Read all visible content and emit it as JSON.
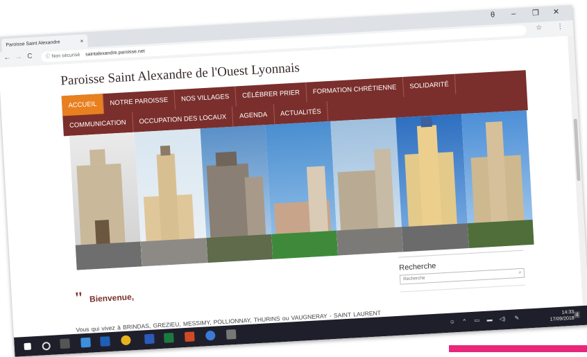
{
  "browser": {
    "tab_title": "Paroisse Saint Alexandre",
    "tab_close": "×",
    "back": "←",
    "forward": "→",
    "reload": "C",
    "security": "ⓘ Non sécurisé",
    "url": "saintalexandre.paroisse.net",
    "star": "☆",
    "menu": "⋮",
    "minimize": "–",
    "maximize": "❐",
    "close": "✕",
    "profile": "θ"
  },
  "site": {
    "title": "Paroisse Saint Alexandre de l'Ouest Lyonnais",
    "menu_row1": [
      "ACCUEIL",
      "NOTRE PAROISSE",
      "NOS VILLAGES",
      "CÉLÉBRER PRIER",
      "FORMATION CHRÉTIENNE",
      "SOLIDARITÉ"
    ],
    "menu_row2": [
      "COMMUNICATION",
      "OCCUPATION DES LOCAUX",
      "AGENDA",
      "ACTUALITÉS"
    ],
    "active_item": "ACCUEIL",
    "welcome_quote": "\"",
    "welcome": "Bienvenue,",
    "intro": "Vous qui vivez à BRINDAS, GREZIEU, MESSIMY, POLLIONNAY, THURINS ou VAUGNERAY - SAINT LAURENT DE VAUX, habitants d'origine ou nouveaux habitants,"
  },
  "sidebar": {
    "search_title": "Recherche",
    "search_placeholder": "Recherche"
  },
  "taskbar": {
    "time": "14:33",
    "date": "17/09/2018",
    "notifications": "4"
  },
  "colors": {
    "menu_bg": "#7a2f2c",
    "menu_active": "#e8801f",
    "accent_pink": "#e8267a"
  }
}
